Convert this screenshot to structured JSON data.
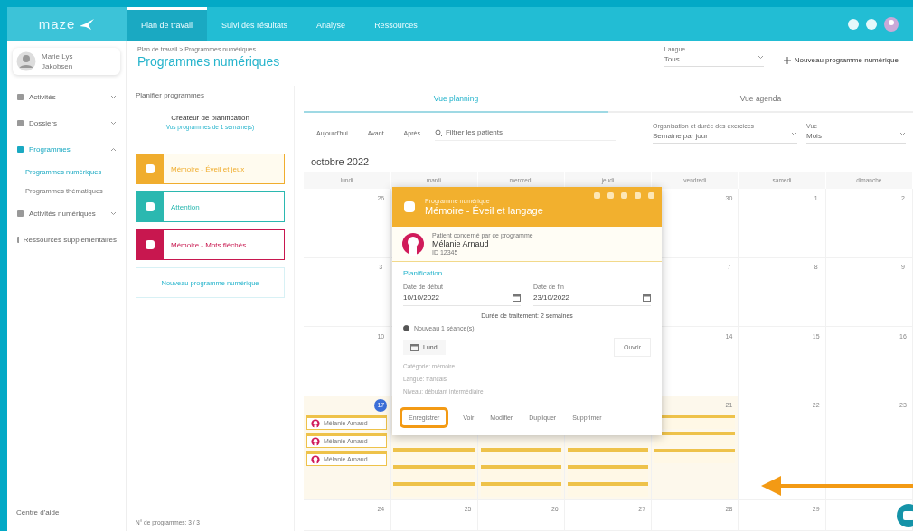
{
  "topbar": {
    "logo": "maze",
    "nav": [
      {
        "label": "Plan de travail",
        "selected": true
      },
      {
        "label": "Suivi des résultats",
        "selected": false
      },
      {
        "label": "Analyse",
        "selected": false
      },
      {
        "label": "Ressources",
        "selected": false
      }
    ]
  },
  "user": {
    "name": "Marie Lys",
    "role": "Jakobsen"
  },
  "sidebar": {
    "items": [
      {
        "label": "Activités",
        "selected": false,
        "expanded": false
      },
      {
        "label": "Dossiers",
        "selected": false,
        "expanded": false
      },
      {
        "label": "Programmes",
        "selected": true,
        "expanded": true,
        "children": [
          {
            "label": "Programmes numériques",
            "selected": true
          },
          {
            "label": "Programmes thématiques",
            "selected": false
          }
        ]
      },
      {
        "label": "Activités numériques",
        "selected": false,
        "expanded": false
      },
      {
        "label": "Ressources supplémentaires",
        "selected": false
      }
    ],
    "footer": "Centre d'aide"
  },
  "header": {
    "breadcrumb": "Plan de travail > Programmes numériques",
    "title": "Programmes numériques",
    "language": {
      "label": "Langue",
      "value": "Tous"
    },
    "new_button": "Nouveau programme numérique"
  },
  "programs": {
    "heading": "Planifier programmes",
    "planner": {
      "title": "Créateur de planification",
      "subtitle": "Vos programmes de 1 semaine(s)"
    },
    "items": [
      {
        "name": "Mémoire - Éveil et jeux",
        "color": "#f0ad2e",
        "selected": true
      },
      {
        "name": "Attention",
        "color": "#2bb8b0",
        "selected": false
      },
      {
        "name": "Mémoire - Mots fléchés",
        "color": "#c8174f",
        "selected": false
      }
    ],
    "add_button": "Nouveau programme numérique",
    "count": "N° de programmes: 3 / 3"
  },
  "calendar": {
    "tabs": [
      {
        "label": "Vue planning",
        "selected": true
      },
      {
        "label": "Vue agenda",
        "selected": false
      }
    ],
    "nav_buttons": [
      "Aujourd'hui",
      "Avant",
      "Après"
    ],
    "filter": "Filtrer les patients",
    "selects": [
      {
        "label": "Organisation et durée des exercices",
        "value": "Semaine par jour"
      },
      {
        "label": "Vue",
        "value": "Mois"
      }
    ],
    "month": "octobre 2022",
    "weekdays": [
      "lundi",
      "mardi",
      "mercredi",
      "jeudi",
      "vendredi",
      "samedi",
      "dimanche"
    ],
    "weeks": [
      [
        {
          "kind": "day",
          "day": "26"
        },
        {
          "kind": "covered"
        },
        {
          "kind": "covered"
        },
        {
          "kind": "covered"
        },
        {
          "kind": "day",
          "day": "30"
        },
        {
          "kind": "day",
          "day": "1"
        },
        {
          "kind": "day",
          "day": "2"
        }
      ],
      [
        {
          "kind": "day",
          "day": "3"
        },
        {
          "kind": "covered"
        },
        {
          "kind": "covered"
        },
        {
          "kind": "covered"
        },
        {
          "kind": "day",
          "day": "7"
        },
        {
          "kind": "day",
          "day": "8"
        },
        {
          "kind": "day",
          "day": "9"
        }
      ],
      [
        {
          "kind": "day",
          "day": "10"
        },
        {
          "kind": "covered"
        },
        {
          "kind": "covered"
        },
        {
          "kind": "covered"
        },
        {
          "kind": "day",
          "day": "14"
        },
        {
          "kind": "day",
          "day": "15"
        },
        {
          "kind": "day",
          "day": "16"
        }
      ],
      [
        {
          "kind": "day",
          "day": "17",
          "today": true,
          "events": [
            {
              "kind": "chip",
              "label": "Mélanie Arnaud"
            },
            {
              "kind": "chip",
              "label": "Mélanie Arnaud"
            },
            {
              "kind": "chip",
              "label": "Mélanie Arnaud"
            }
          ]
        },
        {
          "kind": "covered",
          "events": [
            {
              "kind": "bar"
            },
            {
              "kind": "bar"
            },
            {
              "kind": "bar"
            }
          ]
        },
        {
          "kind": "covered",
          "events": [
            {
              "kind": "bar"
            },
            {
              "kind": "bar"
            },
            {
              "kind": "bar"
            }
          ]
        },
        {
          "kind": "covered",
          "events": [
            {
              "kind": "bar"
            },
            {
              "kind": "bar"
            },
            {
              "kind": "bar"
            }
          ]
        },
        {
          "kind": "day",
          "day": "21",
          "events": [
            {
              "kind": "bar"
            },
            {
              "kind": "bar"
            },
            {
              "kind": "bar"
            }
          ]
        },
        {
          "kind": "day",
          "day": "22"
        },
        {
          "kind": "day",
          "day": "23"
        }
      ],
      [
        {
          "kind": "day",
          "day": "24"
        },
        {
          "kind": "day",
          "day": "25"
        },
        {
          "kind": "day",
          "day": "26"
        },
        {
          "kind": "day",
          "day": "27"
        },
        {
          "kind": "day",
          "day": "28"
        },
        {
          "kind": "day",
          "day": "29"
        },
        {
          "kind": "covered"
        }
      ]
    ]
  },
  "popup": {
    "kicker": "Programme numérique",
    "title": "Mémoire - Éveil et langage",
    "patient_label": "Patient concerné par ce programme",
    "patient_name": "Mélanie Arnaud",
    "patient_id": "ID 12345",
    "section": "Planification",
    "start": {
      "label": "Date de début",
      "value": "10/10/2022"
    },
    "end": {
      "label": "Date de fin",
      "value": "23/10/2022"
    },
    "duration": "Durée de traitement: 2 semaines",
    "option": {
      "label": "Nouveau 1 séance(s)",
      "selected": true
    },
    "session": "Lundi",
    "open_button": "Ouvrir",
    "details": [
      "Catégorie: mémoire",
      "Langue: français",
      "Niveau: débutant intermédiaire"
    ],
    "actions": [
      {
        "label": "Enregistrer",
        "highlighted": true
      },
      {
        "label": "Voir",
        "highlighted": false
      },
      {
        "label": "Modifier",
        "highlighted": false
      },
      {
        "label": "Dupliquer",
        "highlighted": false
      },
      {
        "label": "Supprimer",
        "highlighted": false
      }
    ]
  }
}
